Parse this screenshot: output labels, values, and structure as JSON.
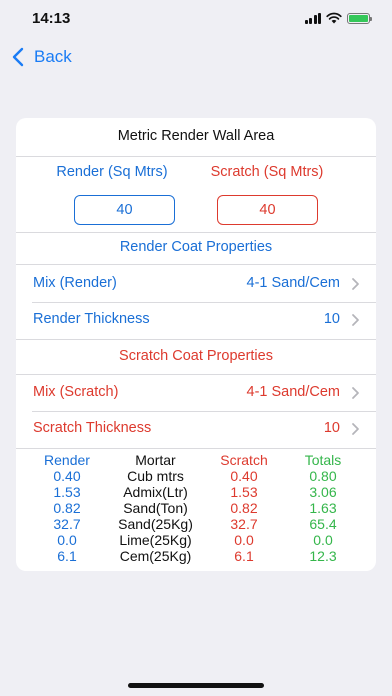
{
  "status_bar": {
    "time": "14:13"
  },
  "nav": {
    "back_label": "Back"
  },
  "card": {
    "title": "Metric Render Wall Area",
    "render_header": "Render (Sq Mtrs)",
    "scratch_header": "Scratch (Sq Mtrs)",
    "render_area": "40",
    "scratch_area": "40",
    "render_section_title": "Render Coat Properties",
    "render_mix_label": "Mix (Render)",
    "render_mix_value": "4-1 Sand/Cem",
    "render_thickness_label": "Render Thickness",
    "render_thickness_value": "10",
    "scratch_section_title": "Scratch Coat Properties",
    "scratch_mix_label": "Mix (Scratch)",
    "scratch_mix_value": "4-1 Sand/Cem",
    "scratch_thickness_label": "Scratch Thickness",
    "scratch_thickness_value": "10"
  },
  "results": {
    "headers": {
      "render": "Render",
      "mortar": "Mortar",
      "scratch": "Scratch",
      "totals": "Totals"
    },
    "render": [
      "0.40",
      "1.53",
      "0.82",
      "32.7",
      "0.0",
      "6.1"
    ],
    "mortar": [
      "Cub mtrs",
      "Admix(Ltr)",
      "Sand(Ton)",
      "Sand(25Kg)",
      "Lime(25Kg)",
      "Cem(25Kg)"
    ],
    "scratch": [
      "0.40",
      "1.53",
      "0.82",
      "32.7",
      "0.0",
      "6.1"
    ],
    "totals": [
      "0.80",
      "3.06",
      "1.63",
      "65.4",
      "0.0",
      "12.3"
    ]
  },
  "colors": {
    "accent_blue": "#1a6fd6",
    "scratch_red": "#dd3a2e",
    "totals_green": "#35b64b",
    "background": "#efeff4"
  }
}
